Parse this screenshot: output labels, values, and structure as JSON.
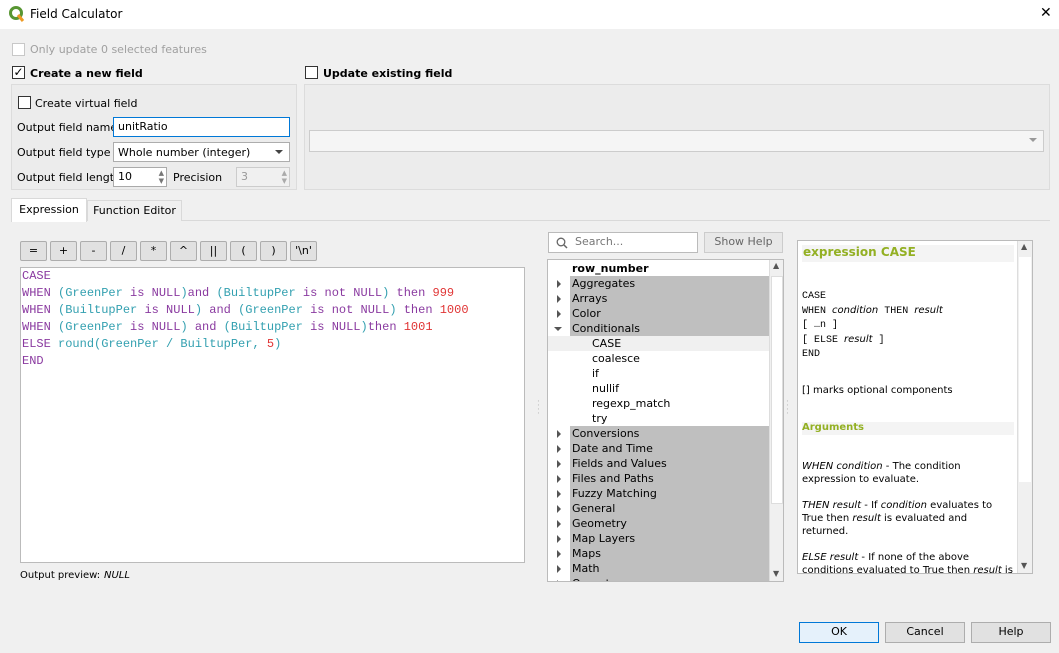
{
  "window": {
    "title": "Field Calculator",
    "close": "✕"
  },
  "only_update": {
    "label": "Only update 0 selected features",
    "checked": false
  },
  "create_new": {
    "label": "Create a new field",
    "checked": true,
    "virtual_label": "Create virtual field",
    "name_label": "Output field name",
    "name_value": "unitRatio",
    "type_label": "Output field type",
    "type_value": "Whole number (integer)",
    "length_label": "Output field length",
    "length_value": "10",
    "precision_label": "Precision",
    "precision_value": "3"
  },
  "update_existing": {
    "label": "Update existing field",
    "checked": false,
    "value": ""
  },
  "tabs": [
    {
      "label": "Expression",
      "active": true
    },
    {
      "label": "Function Editor",
      "active": false
    }
  ],
  "operators": [
    "=",
    "+",
    "-",
    "/",
    "*",
    "^",
    "||",
    "(",
    ")",
    "'\\n'"
  ],
  "expression": [
    [
      [
        "k",
        "CASE"
      ]
    ],
    [
      [
        "k",
        "WHEN "
      ],
      [
        "f",
        "(GreenPer "
      ],
      [
        "k",
        "is NULL"
      ],
      [
        "f",
        ")"
      ],
      [
        "k",
        "and "
      ],
      [
        "f",
        "(BuiltupPer "
      ],
      [
        "k",
        "is not NULL"
      ],
      [
        "f",
        ") "
      ],
      [
        "k",
        "then "
      ],
      [
        "n",
        "999"
      ]
    ],
    [
      [
        "k",
        "WHEN "
      ],
      [
        "f",
        "(BuiltupPer "
      ],
      [
        "k",
        "is NULL"
      ],
      [
        "f",
        ") "
      ],
      [
        "k",
        "and "
      ],
      [
        "f",
        "(GreenPer "
      ],
      [
        "k",
        "is not NULL"
      ],
      [
        "f",
        ") "
      ],
      [
        "k",
        "then "
      ],
      [
        "n",
        "1000"
      ]
    ],
    [
      [
        "k",
        "WHEN "
      ],
      [
        "f",
        "(GreenPer "
      ],
      [
        "k",
        "is NULL"
      ],
      [
        "f",
        ") "
      ],
      [
        "k",
        "and "
      ],
      [
        "f",
        "(BuiltupPer "
      ],
      [
        "k",
        "is NULL"
      ],
      [
        "f",
        ")"
      ],
      [
        "k",
        "then "
      ],
      [
        "n",
        "1001"
      ]
    ],
    [
      [
        "k",
        "ELSE "
      ],
      [
        "f",
        "round(GreenPer / BuiltupPer, "
      ],
      [
        "n",
        "5"
      ],
      [
        "f",
        ")"
      ]
    ],
    [
      [
        "k",
        "END"
      ]
    ]
  ],
  "output_preview": {
    "label": "Output preview:",
    "value": "NULL"
  },
  "search": {
    "placeholder": "Search...",
    "show_help": "Show Help"
  },
  "tree": {
    "top": "row_number",
    "groups_before": [
      "Aggregates",
      "Arrays",
      "Color"
    ],
    "open_group": "Conditionals",
    "children": [
      "CASE",
      "coalesce",
      "if",
      "nullif",
      "regexp_match",
      "try"
    ],
    "selected_child": "CASE",
    "groups_after": [
      "Conversions",
      "Date and Time",
      "Fields and Values",
      "Files and Paths",
      "Fuzzy Matching",
      "General",
      "Geometry",
      "Map Layers",
      "Maps",
      "Math",
      "Operators"
    ]
  },
  "help": {
    "title": "expression CASE",
    "syntax": [
      "CASE",
      "WHEN |condition| THEN |result|",
      "[ …n ]",
      "[ ELSE |result| ]",
      "END"
    ],
    "note": "[] marks optional components",
    "arguments_title": "Arguments",
    "args": [
      [
        "WHEN condition",
        " - The condition expression to evaluate."
      ],
      [
        "THEN result",
        " - If ",
        "condition",
        " evaluates to True then ",
        "result",
        " is evaluated and returned."
      ],
      [
        "ELSE result",
        " - If none of the above conditions evaluated to True then ",
        "result",
        " is evaluated and returned."
      ]
    ],
    "accent": "#93b023"
  },
  "buttons": {
    "ok": "OK",
    "cancel": "Cancel",
    "help": "Help"
  }
}
